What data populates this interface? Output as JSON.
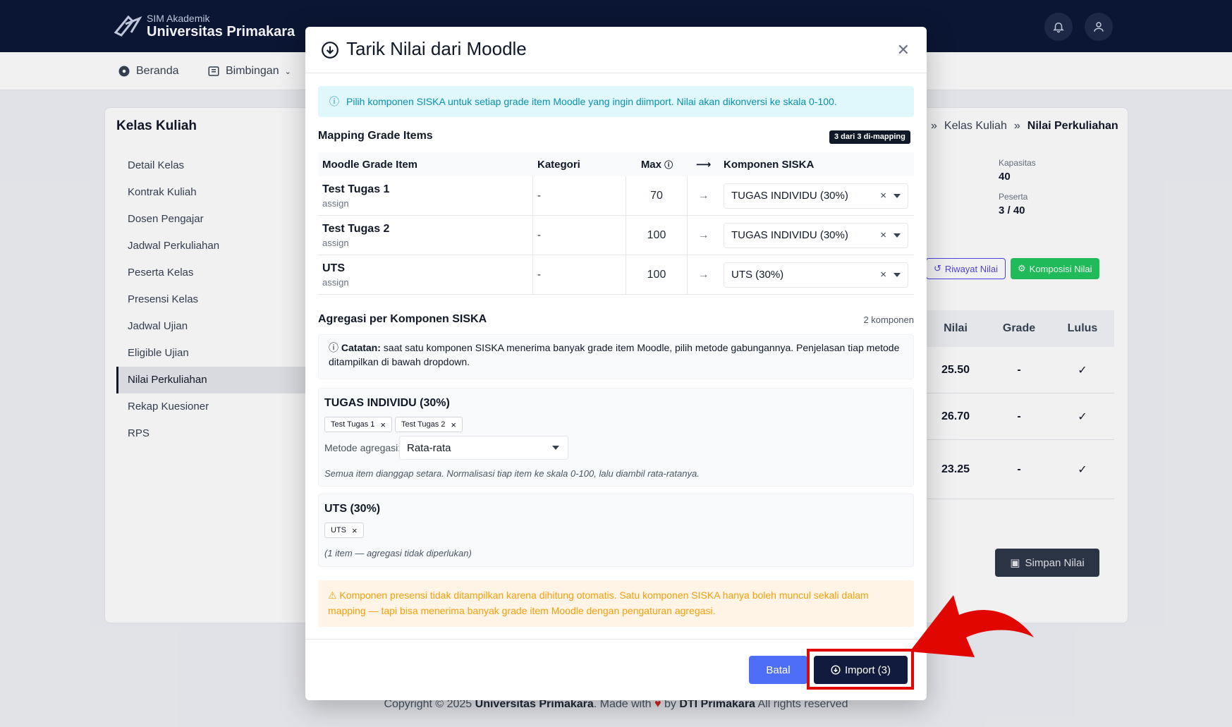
{
  "header": {
    "brand_small": "SIM Akademik",
    "brand_big": "Universitas Primakara",
    "notification_icon": "bell-icon",
    "user_icon": "user-icon"
  },
  "nav": {
    "items": [
      {
        "label": "Beranda",
        "icon": "dashboard-icon"
      },
      {
        "label": "Bimbingan",
        "icon": "book-icon"
      }
    ]
  },
  "page": {
    "title": "Kelas Kuliah",
    "breadcrumbs": [
      "Kelas Kuliah",
      "Nilai Perkuliahan"
    ],
    "sidebar": [
      {
        "label": "Detail Kelas",
        "active": false
      },
      {
        "label": "Kontrak Kuliah",
        "active": false
      },
      {
        "label": "Dosen Pengajar",
        "active": false
      },
      {
        "label": "Jadwal Perkuliahan",
        "active": false
      },
      {
        "label": "Peserta Kelas",
        "active": false
      },
      {
        "label": "Presensi Kelas",
        "active": false
      },
      {
        "label": "Jadwal Ujian",
        "active": false
      },
      {
        "label": "Eligible Ujian",
        "active": false
      },
      {
        "label": "Nilai Perkuliahan",
        "active": true
      },
      {
        "label": "Rekap Kuesioner",
        "active": false
      },
      {
        "label": "RPS",
        "active": false
      }
    ],
    "stats": {
      "kapasitas_label": "Kapasitas",
      "kapasitas_value": "40",
      "peserta_label": "Peserta",
      "peserta_value": "3 / 40"
    },
    "buttons": {
      "riwayat": "Riwayat Nilai",
      "komposisi": "Komposisi Nilai",
      "simpan": "Simpan Nilai"
    },
    "grade_table": {
      "headers": [
        "Nilai",
        "Grade",
        "Lulus"
      ],
      "rows": [
        {
          "nilai": "25.50",
          "grade": "-",
          "lulus": "✓"
        },
        {
          "nilai": "26.70",
          "grade": "-",
          "lulus": "✓"
        },
        {
          "nilai": "23.25",
          "grade": "-",
          "lulus": "✓"
        }
      ]
    }
  },
  "modal": {
    "title": "Tarik Nilai dari Moodle",
    "info": "Pilih komponen SISKA untuk setiap grade item Moodle yang ingin diimport. Nilai akan dikonversi ke skala 0-100.",
    "mapping_title": "Mapping Grade Items",
    "mapping_badge": "3 dari 3 di-mapping",
    "table_headers": {
      "item": "Moodle Grade Item",
      "kategori": "Kategori",
      "max": "Max",
      "arrow": "⟶",
      "komponen": "Komponen SISKA"
    },
    "rows": [
      {
        "name": "Test Tugas 1",
        "type": "assign",
        "kategori": "-",
        "max": "70",
        "komponen": "TUGAS INDIVIDU (30%)"
      },
      {
        "name": "Test Tugas 2",
        "type": "assign",
        "kategori": "-",
        "max": "100",
        "komponen": "TUGAS INDIVIDU (30%)"
      },
      {
        "name": "UTS",
        "type": "assign",
        "kategori": "-",
        "max": "100",
        "komponen": "UTS (30%)"
      }
    ],
    "agregasi_title": "Agregasi per Komponen SISKA",
    "agregasi_count": "2 komponen",
    "note_bold": "Catatan:",
    "note_text": " saat satu komponen SISKA menerima banyak grade item Moodle, pilih metode gabungannya. Penjelasan tiap metode ditampilkan di bawah dropdown.",
    "groups": [
      {
        "title": "TUGAS INDIVIDU (30%)",
        "chips": [
          "Test Tugas 1",
          "Test Tugas 2"
        ],
        "method_label": "Metode agregasi:",
        "method_value": "Rata-rata",
        "desc": "Semua item dianggap setara. Normalisasi tiap item ke skala 0-100, lalu diambil rata-ratanya."
      },
      {
        "title": "UTS (30%)",
        "chips": [
          "UTS"
        ],
        "desc": "(1 item — agregasi tidak diperlukan)"
      }
    ],
    "warning": "Komponen presensi tidak ditampilkan karena dihitung otomatis. Satu komponen SISKA hanya boleh muncul sekali dalam mapping — tapi bisa menerima banyak grade item Moodle dengan pengaturan agregasi.",
    "cancel_label": "Batal",
    "import_label": "Import (3)"
  },
  "footer": {
    "prefix": "Copyright © 2025 ",
    "org": "Universitas Primakara",
    "made": ". Made with ",
    "by": " by ",
    "team": "DTI Primakara",
    "suffix": " All rights reserved"
  },
  "colors": {
    "header_bg": "#0b1736",
    "accent": "#4f6ef7",
    "import_bg": "#111b3d",
    "info_text": "#0891b2",
    "warning_text": "#f59e0b",
    "annotation_red": "#e10600"
  }
}
